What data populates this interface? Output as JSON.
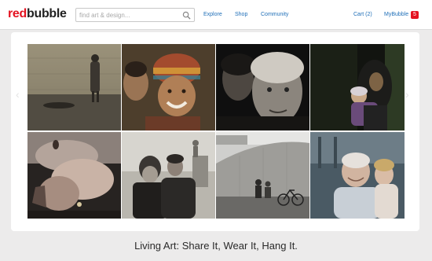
{
  "header": {
    "logo_red": "red",
    "logo_black": "bubble",
    "search_placeholder": "find art & design...",
    "nav": [
      {
        "label": "Explore"
      },
      {
        "label": "Shop"
      },
      {
        "label": "Community"
      }
    ],
    "cart_label": "Cart (2)",
    "account_label": "MyBubble",
    "account_badge": "5"
  },
  "gallery": {
    "prev_label": "‹",
    "next_label": "›",
    "tiles": [
      {
        "subject": "woman standing by stone wall with man lying on pavement"
      },
      {
        "subject": "smiling girl in knit hat with younger child"
      },
      {
        "subject": "two elderly faces in dark portrait"
      },
      {
        "subject": "mother in headscarf holding baby"
      },
      {
        "subject": "close-up of woman kissing hand"
      },
      {
        "subject": "young couple embracing on street"
      },
      {
        "subject": "people sitting by curved concrete wall with bicycle"
      },
      {
        "subject": "elderly woman and girl laughing together"
      }
    ]
  },
  "tagline": "Living Art: Share It, Wear It, Hang It.",
  "colors": {
    "brand_red": "#e41321",
    "link_blue": "#1f6fb8",
    "page_bg": "#ecebeb"
  }
}
